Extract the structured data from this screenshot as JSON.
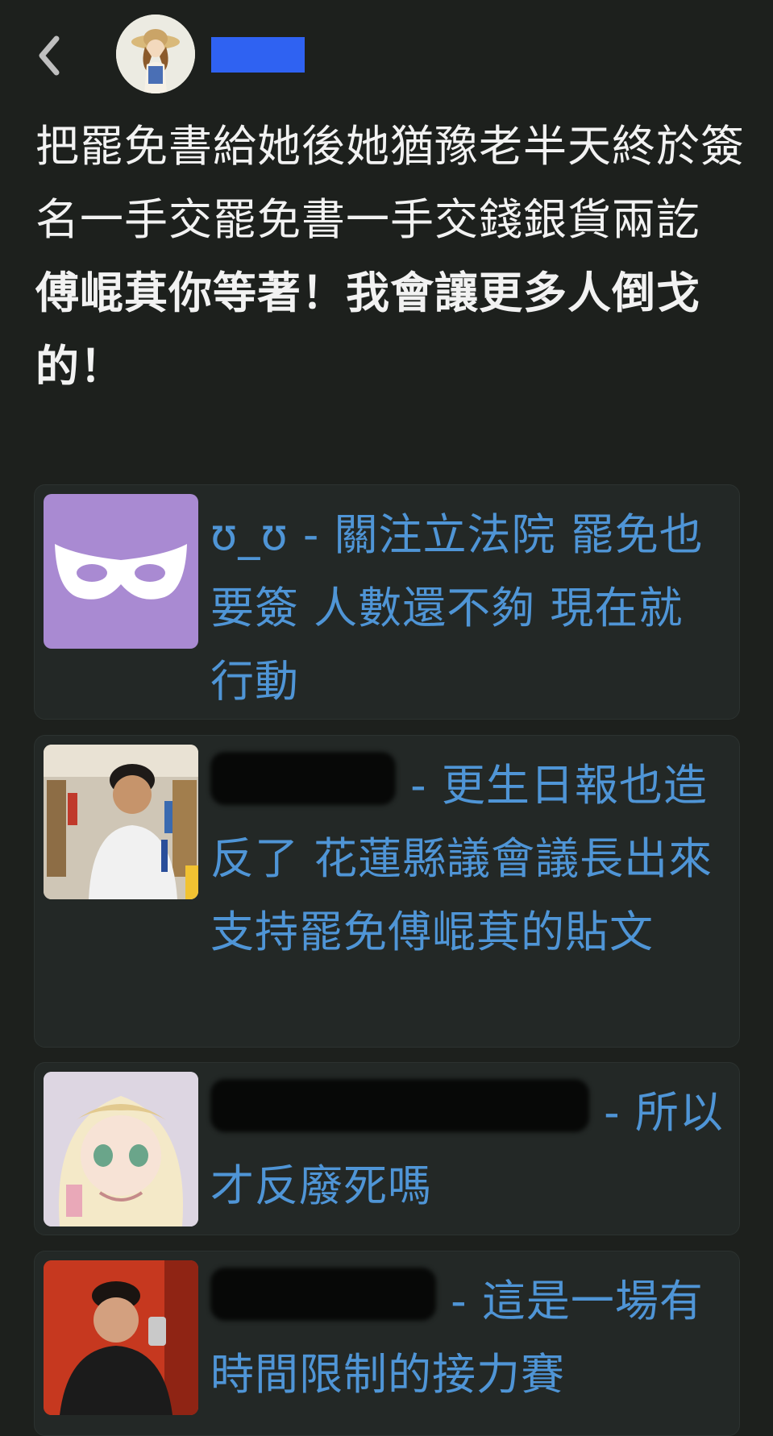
{
  "post": {
    "paragraph1": "把罷免書給她後她猶豫老半天終於簽名一手交罷免書一手交錢銀貨兩訖",
    "paragraph2": "傅崐萁你等著！我會讓更多人倒戈的！"
  },
  "comments": [
    {
      "user": "ʊ_ʊ",
      "separator": " - ",
      "text": "關注立法院 罷免也要簽 人數還不夠 現在就行動"
    },
    {
      "user": "",
      "separator": " - ",
      "text": "更生日報也造反了 花蓮縣議會議長出來支持罷免傅崐萁的貼文"
    },
    {
      "user": "",
      "separator": " - ",
      "text": "所以才反廢死嗎"
    },
    {
      "user": "",
      "separator": " - ",
      "text": "這是一場有時間限制的接力賽"
    }
  ],
  "colors": {
    "background": "#1d201d",
    "link": "#4f95d6",
    "redaction": "#2f62f2",
    "mask_tile": "#a98ad2"
  },
  "icons": {
    "back": "chevron-left-icon",
    "mask": "mask-icon"
  }
}
